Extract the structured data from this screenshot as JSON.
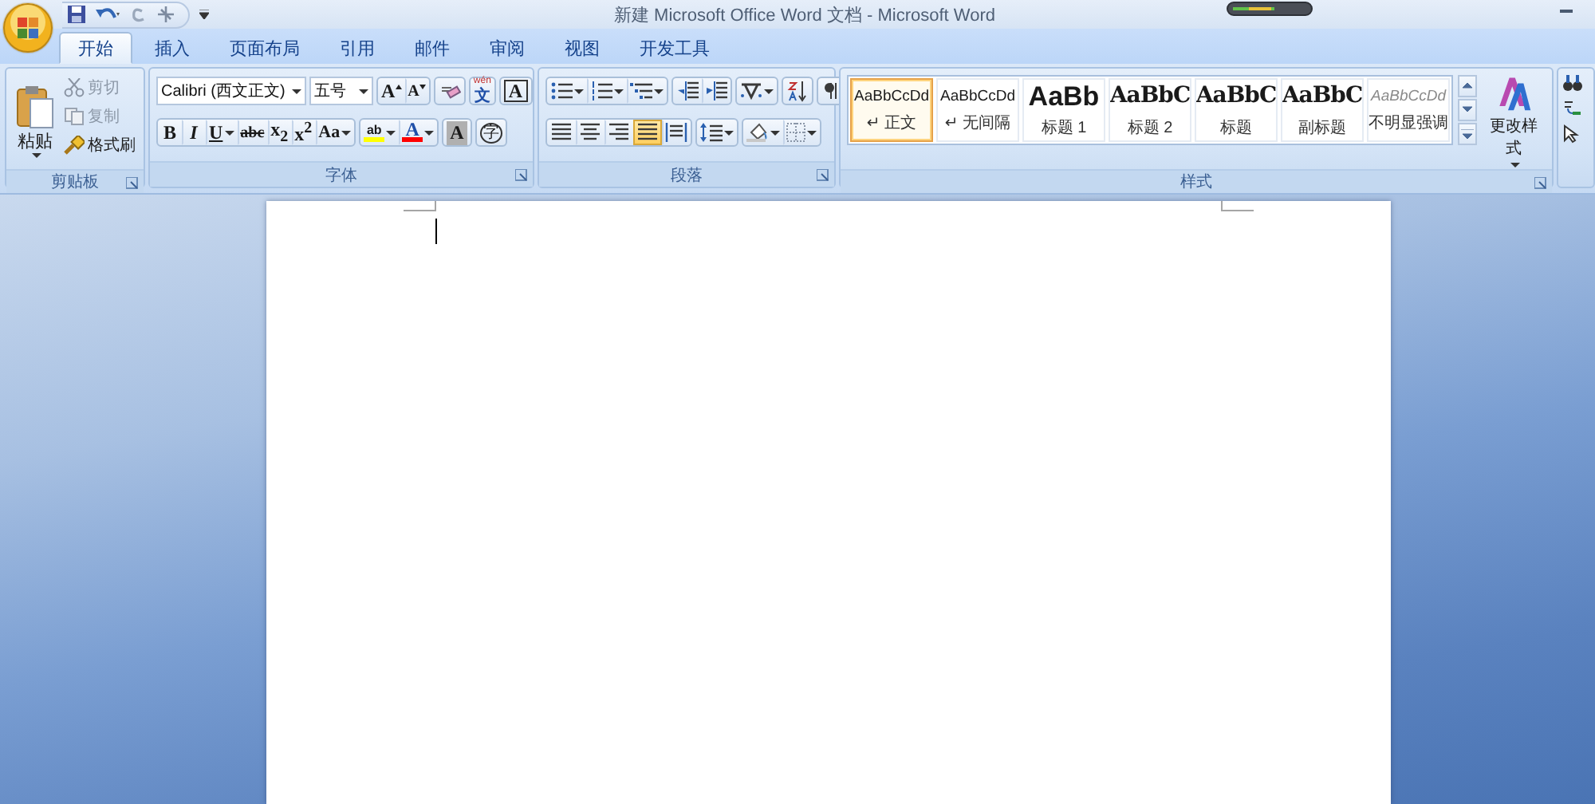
{
  "window": {
    "title": "新建 Microsoft Office Word 文档 - Microsoft Word"
  },
  "tabs": [
    {
      "label": "开始",
      "selected": true
    },
    {
      "label": "插入",
      "selected": false
    },
    {
      "label": "页面布局",
      "selected": false
    },
    {
      "label": "引用",
      "selected": false
    },
    {
      "label": "邮件",
      "selected": false
    },
    {
      "label": "审阅",
      "selected": false
    },
    {
      "label": "视图",
      "selected": false
    },
    {
      "label": "开发工具",
      "selected": false
    }
  ],
  "clipboard": {
    "paste": "粘贴",
    "group_label": "剪贴板",
    "items": [
      {
        "kind": "cut",
        "label": "剪切",
        "disabled": true
      },
      {
        "kind": "copy",
        "label": "复制",
        "disabled": true
      },
      {
        "kind": "painter",
        "label": "格式刷",
        "disabled": false
      }
    ]
  },
  "font": {
    "group_label": "字体",
    "font_name": "Calibri (西文正文)",
    "font_size": "五号",
    "row1": [
      {
        "kind": "grow",
        "glyph": "A"
      },
      {
        "kind": "shrink",
        "glyph": "A"
      },
      {
        "kind": "clear"
      },
      {
        "kind": "phonetic",
        "pinyin": "wén",
        "glyph": "文"
      },
      {
        "kind": "border",
        "glyph": "A"
      }
    ],
    "row2": [
      {
        "kind": "bold",
        "glyph": "B"
      },
      {
        "kind": "italic",
        "glyph": "I"
      },
      {
        "kind": "underline",
        "glyph": "U",
        "dropdown": true
      },
      {
        "kind": "strike",
        "glyph": "abc"
      },
      {
        "kind": "script",
        "glyph": "x$_{2}$"
      },
      {
        "kind": "script",
        "glyph": "x$^{2}$"
      },
      {
        "kind": "case",
        "glyph": "Aa",
        "dropdown": true
      },
      {
        "kind": "highlight",
        "glyph": "ab",
        "color": "#ffff00",
        "dropdown": true
      },
      {
        "kind": "color",
        "glyph": "A",
        "color": "#ff0000",
        "dropdown": true
      },
      {
        "kind": "shading",
        "glyph": "A"
      },
      {
        "kind": "enclose",
        "glyph": "字"
      }
    ]
  },
  "paragraph": {
    "group_label": "段落",
    "row1": [
      {
        "kind": "bullets",
        "dropdown": true
      },
      {
        "kind": "numbering",
        "dropdown": true
      },
      {
        "kind": "multilevel",
        "dropdown": true
      },
      {
        "kind": "outdent"
      },
      {
        "kind": "indent"
      },
      {
        "kind": "asian",
        "dropdown": true
      },
      {
        "kind": "sort"
      },
      {
        "kind": "marks"
      }
    ],
    "alignments": [
      {
        "kind": "left",
        "selected": false
      },
      {
        "kind": "center",
        "selected": false
      },
      {
        "kind": "right",
        "selected": false
      },
      {
        "kind": "justify",
        "selected": true
      },
      {
        "kind": "distribute",
        "selected": false
      }
    ],
    "row2": [
      {
        "kind": "spacing",
        "dropdown": true
      },
      {
        "kind": "fill",
        "dropdown": true
      },
      {
        "kind": "borders",
        "dropdown": true
      }
    ]
  },
  "styles": {
    "group_label": "样式",
    "change": "更改样式",
    "items": [
      {
        "kind": "normal",
        "sample": "AaBbCcDd",
        "name": "↵ 正文",
        "selected": true
      },
      {
        "kind": "normal",
        "sample": "AaBbCcDd",
        "name": "↵ 无间隔",
        "selected": false
      },
      {
        "kind": "heading1",
        "sample": "AaBb",
        "name": "标题 1",
        "selected": false
      },
      {
        "kind": "heading",
        "sample": "AaBbC",
        "name": "标题 2",
        "selected": false
      },
      {
        "kind": "heading",
        "sample": "AaBbC",
        "name": "标题",
        "selected": false
      },
      {
        "kind": "heading",
        "sample": "AaBbC",
        "name": "副标题",
        "selected": false
      },
      {
        "kind": "subtle",
        "sample": "AaBbCcDd",
        "name": "不明显强调",
        "selected": false
      }
    ]
  }
}
